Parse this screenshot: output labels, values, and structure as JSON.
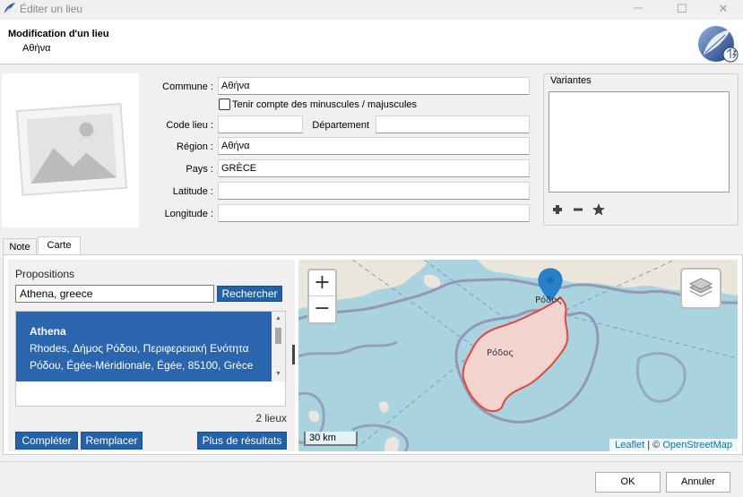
{
  "window": {
    "title": "Éditer un lieu",
    "maximize_glyph": "☐",
    "close_glyph": "✕"
  },
  "header": {
    "title": "Modification d'un lieu",
    "subtitle": "Αθήνα"
  },
  "form": {
    "commune_label": "Commune :",
    "commune_value": "Αθήνα",
    "case_label": "Tenir compte des minuscules / majuscules",
    "code_label": "Code lieu :",
    "code_value": "",
    "dept_label": "Département",
    "dept_value": "",
    "region_label": "Région :",
    "region_value": "Αθήνα",
    "pays_label": "Pays :",
    "pays_value": "GRÈCE",
    "lat_label": "Latitude :",
    "lat_value": "",
    "lon_label": "Longitude :",
    "lon_value": ""
  },
  "variants": {
    "title": "Variantes",
    "add_icon": "plus-icon",
    "remove_icon": "minus-icon",
    "favorite_icon": "star-icon"
  },
  "tabs": [
    {
      "label": "Note"
    },
    {
      "label": "Carte"
    }
  ],
  "propositions": {
    "title": "Propositions",
    "search_value": "Athena, greece",
    "search_button": "Rechercher",
    "result": {
      "name": "Athena",
      "line1": "Rhodes, Δήμος Ρόδου, Περιφερειακή Ενότητα",
      "line2": "Ρόδου, Égée-Méridionale, Égée, 85100, Grèce"
    },
    "count": "2 lieux",
    "complete_button": "Compléter",
    "replace_button": "Remplacer",
    "more_button": "Plus de résultats"
  },
  "map": {
    "zoom_in": "+",
    "zoom_out": "−",
    "scale": "30 km",
    "attribution_leaflet": "Leaflet",
    "attribution_sep": " | © ",
    "attribution_osm": "OpenStreetMap",
    "label_city": "Ρόδος",
    "label_island": "Ρόδος",
    "colors": {
      "sea": "#a9d3de",
      "land": "#eae6dc",
      "island_fill": "#f2d3cf",
      "island_border": "#e0483f",
      "boundary": "#8a7fa8",
      "marker": "#2a81cb"
    }
  },
  "footer": {
    "ok_button": "OK",
    "cancel_button": "Annuler"
  }
}
